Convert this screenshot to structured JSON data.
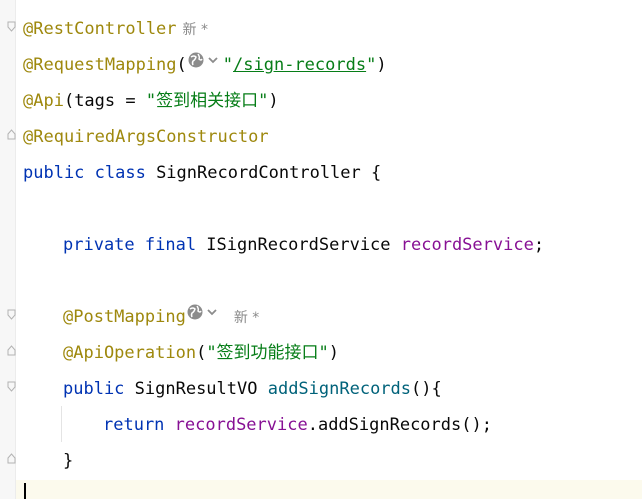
{
  "editor": {
    "lines": [
      {
        "ann": "@RestController",
        "inlay": "新 *"
      },
      {
        "ann": "@RequestMapping",
        "open": "(",
        "url": "/sign-records",
        "close": ")"
      },
      {
        "ann": "@Api",
        "rest": "(tags = ",
        "str": "\"签到相关接口\"",
        "close": ")"
      },
      {
        "ann": "@RequiredArgsConstructor"
      },
      {
        "kw": "public class",
        "name": " SignRecordController {"
      },
      {
        "kw": "private final",
        "type": " ISignRecordService ",
        "field": "recordService",
        "end": ";"
      },
      {
        "ann": "@PostMapping",
        "inlay": "新 *"
      },
      {
        "ann": "@ApiOperation",
        "open": "(",
        "str": "\"签到功能接口\"",
        "close": ")"
      },
      {
        "kw": "public",
        "type": " SignResultVO ",
        "meth": "addSignRecords",
        "end": "(){"
      },
      {
        "kw": "return",
        "field": " recordService",
        "rest": ".addSignRecords();"
      },
      {
        "close": "}"
      }
    ]
  }
}
